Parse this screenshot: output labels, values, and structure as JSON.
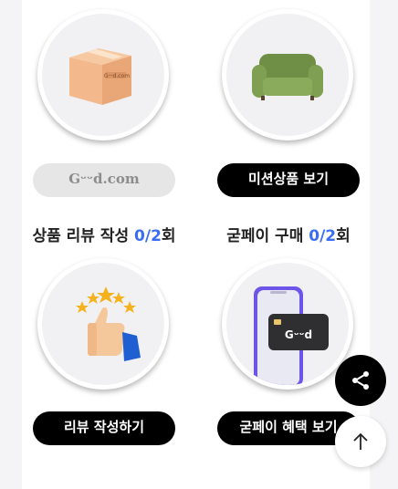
{
  "missions": [
    {
      "id": "good-com",
      "button_label": "Gᵕᵕd.com",
      "button_style": "light",
      "icon": "box-icon"
    },
    {
      "id": "mission-product",
      "button_label": "미션상품 보기",
      "button_style": "dark",
      "icon": "sofa-icon"
    },
    {
      "id": "review",
      "title_prefix": "상품 리뷰 작성 ",
      "count": "0/2",
      "title_suffix": "회",
      "button_label": "리뷰 작성하기",
      "button_style": "dark",
      "icon": "thumbs-up-stars-icon"
    },
    {
      "id": "goodpay",
      "title_prefix": "굳페이 구매 ",
      "count": "0/2",
      "title_suffix": "회",
      "button_label": "굳페이 혜택 보기",
      "button_style": "dark",
      "icon": "phone-card-icon",
      "card_logo": "Gᵕᵕd"
    }
  ],
  "box_logo": "Gᵕᵕd.com",
  "fab": {
    "share_icon": "share-icon",
    "top_icon": "arrow-up-icon"
  },
  "colors": {
    "accent": "#3b6df2",
    "button_dark": "#000000",
    "button_light": "#e6e6e6"
  }
}
